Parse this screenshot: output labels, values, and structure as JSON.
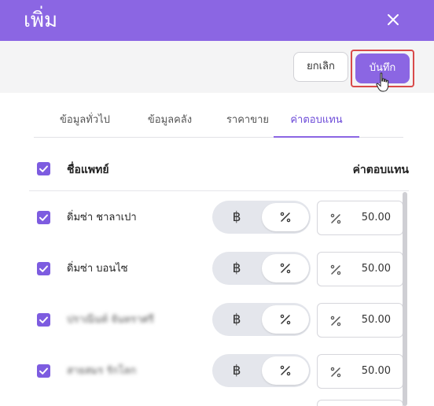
{
  "header": {
    "title": "เพิ่ม",
    "close_icon": "close-icon"
  },
  "toolbar": {
    "cancel_label": "ยกเลิก",
    "save_label": "บันทึก"
  },
  "tabs": [
    {
      "label": "ข้อมูลทั่วไป",
      "active": false
    },
    {
      "label": "ข้อมูลคลัง",
      "active": false
    },
    {
      "label": "ราคาขาย",
      "active": false
    },
    {
      "label": "ค่าตอบแทน",
      "active": true
    }
  ],
  "list": {
    "head_name": "ชื่อแพทย์",
    "head_fee": "ค่าตอบแทน",
    "rows": [
      {
        "name": "ดิ่มซ่า ชาลาเปา",
        "blurred": false,
        "mode": "percent",
        "value": "50.00",
        "checked": true
      },
      {
        "name": "ดิ่มซ่า บอนไซ",
        "blurred": false,
        "mode": "percent",
        "value": "50.00",
        "checked": true
      },
      {
        "name": "ปราณีนท์ จันทราศรี",
        "blurred": true,
        "mode": "percent",
        "value": "50.00",
        "checked": true
      },
      {
        "name": "สายสมร รักโลก",
        "blurred": true,
        "mode": "percent",
        "value": "50.00",
        "checked": true
      }
    ],
    "baht_symbol": "฿"
  },
  "colors": {
    "accent": "#8b66e3",
    "highlight": "#d94a4a"
  }
}
